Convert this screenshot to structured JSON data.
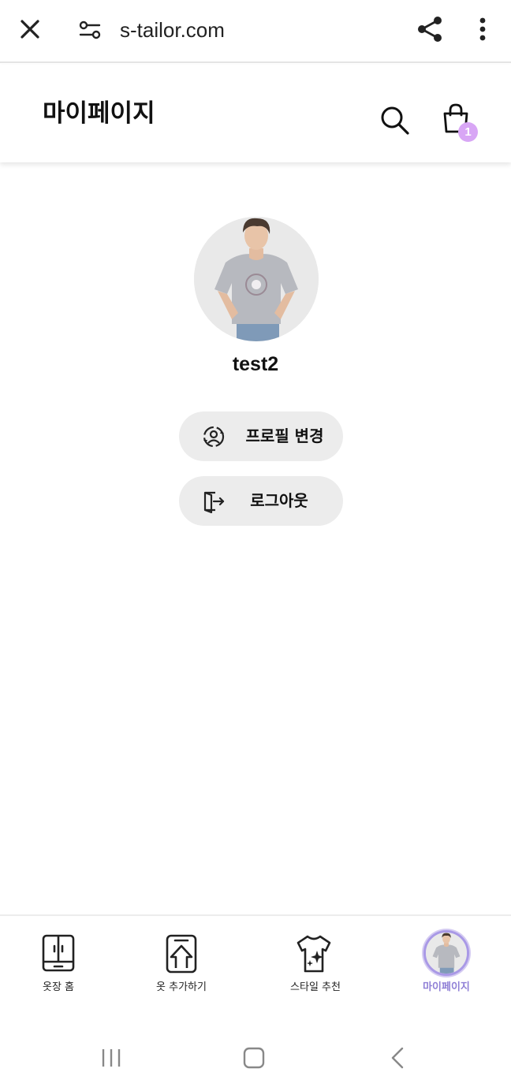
{
  "browser": {
    "url": "s-tailor.com",
    "icons": [
      "close-icon",
      "site-settings-icon",
      "share-icon",
      "more-vert-icon"
    ]
  },
  "header": {
    "title": "마이페이지",
    "cart_count": "1",
    "badge_color": "#d8a6f5",
    "icons": [
      "search-icon",
      "shopping-bag-icon"
    ]
  },
  "profile": {
    "username": "test2",
    "avatar": "person-in-grey-tshirt"
  },
  "actions": {
    "edit_profile": "프로필 변경",
    "logout": "로그아웃"
  },
  "bottom_nav": {
    "active_color": "#8f7fd6",
    "items": [
      {
        "label": "옷장 홈",
        "icon": "wardrobe-icon"
      },
      {
        "label": "옷 추가하기",
        "icon": "add-clothes-icon"
      },
      {
        "label": "스타일 추천",
        "icon": "tshirt-sparkle-icon"
      },
      {
        "label": "마이페이지",
        "icon": "avatar",
        "active": true
      }
    ]
  },
  "system_nav": [
    "recent-apps",
    "home",
    "back"
  ]
}
